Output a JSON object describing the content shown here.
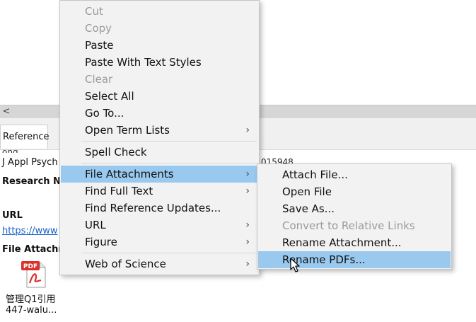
{
  "background": {
    "tab_label": "Reference",
    "journal_line": "J Appl Psych",
    "research_label": "Research N",
    "url_label": "URL",
    "url_value": "https://www",
    "file_attach_label": "File Attachm",
    "file_caption_line1": "管理Q1引用",
    "file_caption_line2": "447-walu...",
    "partial_number": "015948",
    "scroll_left_glyph": "<",
    "pdf_icon_label": "PDF"
  },
  "context_menu": {
    "items": [
      {
        "label": "Cut",
        "enabled": false
      },
      {
        "label": "Copy",
        "enabled": false
      },
      {
        "label": "Paste",
        "enabled": true
      },
      {
        "label": "Paste With Text Styles",
        "enabled": true
      },
      {
        "label": "Clear",
        "enabled": false
      },
      {
        "label": "Select All",
        "enabled": true
      },
      {
        "label": "Go To...",
        "enabled": true
      },
      {
        "label": "Open Term Lists",
        "enabled": true,
        "submenu": true
      },
      {
        "label": "Spell Check",
        "enabled": true
      },
      {
        "label": "File Attachments",
        "enabled": true,
        "submenu": true,
        "highlighted": true
      },
      {
        "label": "Find Full Text",
        "enabled": true,
        "submenu": true
      },
      {
        "label": "Find Reference Updates...",
        "enabled": true
      },
      {
        "label": "URL",
        "enabled": true,
        "submenu": true
      },
      {
        "label": "Figure",
        "enabled": true,
        "submenu": true
      },
      {
        "label": "Web of Science",
        "enabled": true,
        "submenu": true
      }
    ],
    "chevron_glyph": "›"
  },
  "submenu": {
    "items": [
      {
        "label": "Attach File...",
        "enabled": true
      },
      {
        "label": "Open File",
        "enabled": true
      },
      {
        "label": "Save As...",
        "enabled": true
      },
      {
        "label": "Convert to Relative Links",
        "enabled": false
      },
      {
        "label": "Rename Attachment...",
        "enabled": true
      },
      {
        "label": "Rename PDFs...",
        "enabled": true,
        "highlighted": true
      }
    ]
  },
  "colors": {
    "highlight": "#99c9ef",
    "menu_bg": "#f2f2f2",
    "disabled_text": "#9a9a9a",
    "link": "#1a63c6"
  },
  "icons": {
    "cursor": "mouse-pointer-icon",
    "pdf": "adobe-pdf-file-icon"
  }
}
